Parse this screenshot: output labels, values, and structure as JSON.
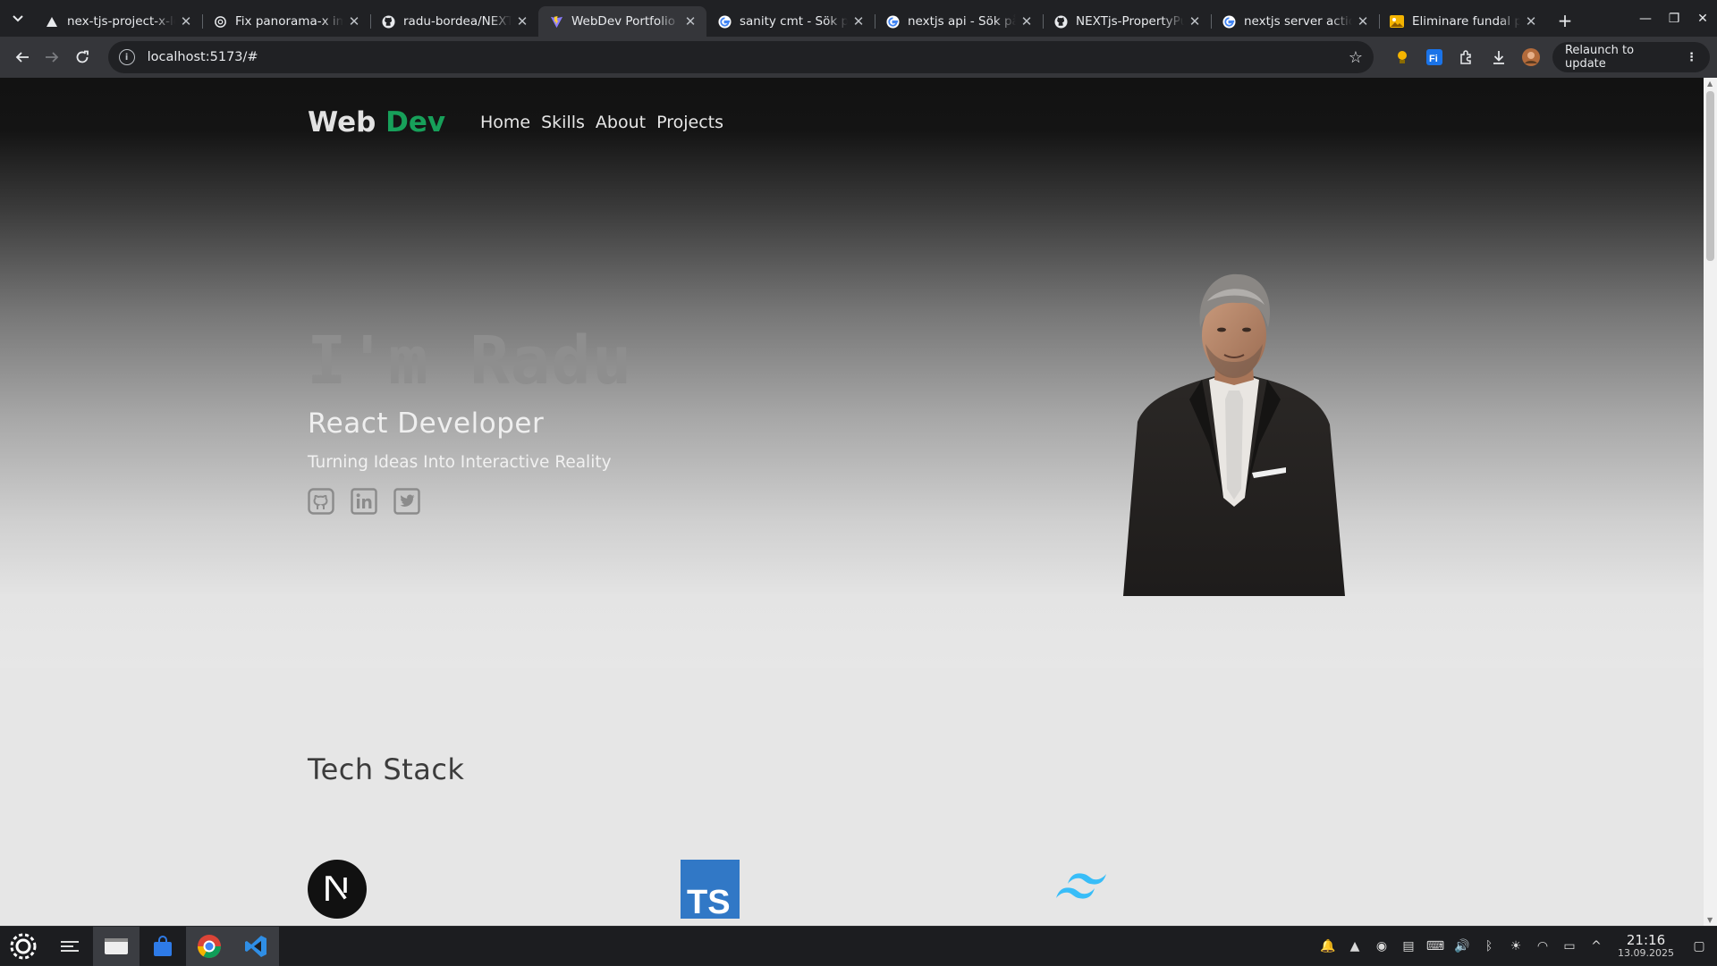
{
  "browser": {
    "tabs": [
      {
        "title": "nex-tjs-project-x-lol",
        "favicon": "vercel-triangle-icon",
        "active": false
      },
      {
        "title": "Fix panorama-x image",
        "favicon": "openai-icon",
        "active": false
      },
      {
        "title": "radu-bordea/NEXTjs",
        "favicon": "github-icon",
        "active": false
      },
      {
        "title": "WebDev Portfolio",
        "favicon": "vite-icon",
        "active": true
      },
      {
        "title": "sanity cmt - Sök på Google",
        "favicon": "google-icon",
        "active": false
      },
      {
        "title": "nextjs api - Sök på Google",
        "favicon": "google-icon",
        "active": false
      },
      {
        "title": "NEXTjs-PropertyPulse",
        "favicon": "github-icon",
        "active": false
      },
      {
        "title": "nextjs server actions",
        "favicon": "google-icon",
        "active": false
      },
      {
        "title": "Eliminare fundal poze",
        "favicon": "photo-icon",
        "active": false
      }
    ],
    "url": "localhost:5173/#",
    "relaunch_label": "Relaunch to update"
  },
  "site": {
    "brand_main": "Web",
    "brand_accent": "Dev",
    "nav": [
      "Home",
      "Skills",
      "About",
      "Projects"
    ],
    "hero": {
      "headline": "I'm Radu",
      "role": "React Developer",
      "tagline": "Turning Ideas Into Interactive Reality",
      "socials": [
        "github-icon",
        "linkedin-icon",
        "twitter-icon"
      ]
    },
    "tech_stack_title": "Tech Stack",
    "tech_stack": [
      "nextjs-icon",
      "typescript-icon",
      "tailwind-icon"
    ],
    "colors": {
      "accent": "#17a05a",
      "typescript": "#3178c6",
      "tailwind": "#38bdf8"
    }
  },
  "taskbar": {
    "time": "21:16",
    "date": "13.09.2025"
  }
}
